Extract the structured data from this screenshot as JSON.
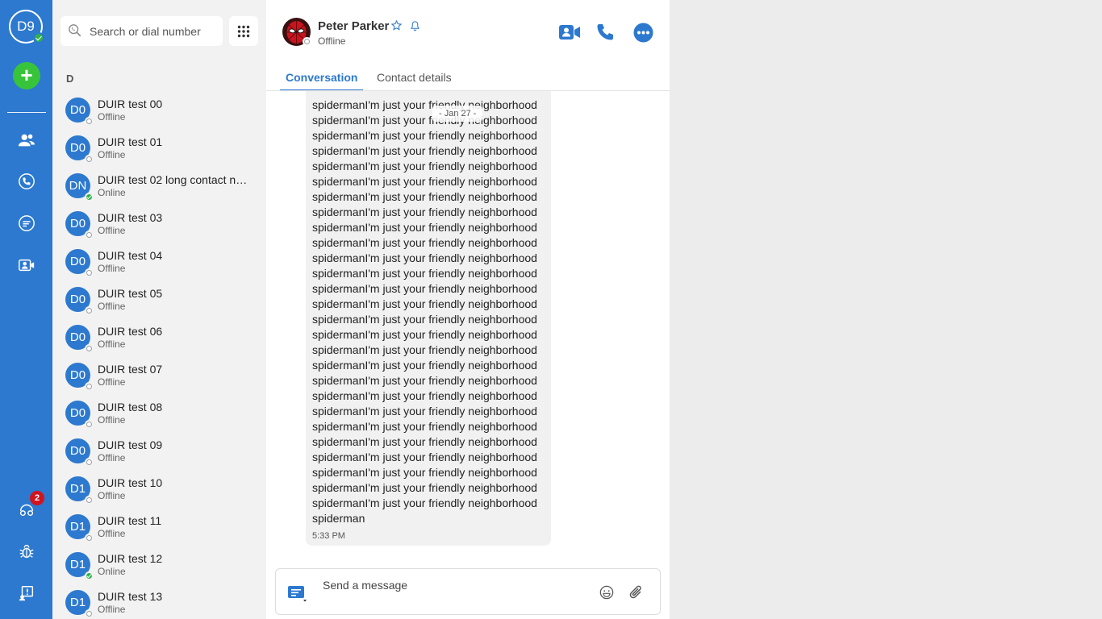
{
  "rail": {
    "user_initials": "D9",
    "notification_count": "2"
  },
  "contacts": {
    "search_placeholder": "Search or dial number",
    "group_letter": "D",
    "items": [
      {
        "initials": "D0",
        "name": "DUIR test 00",
        "status": "Offline"
      },
      {
        "initials": "D0",
        "name": "DUIR test 01",
        "status": "Offline"
      },
      {
        "initials": "DN",
        "name": "DUIR test 02 long contact na...",
        "status": "Online"
      },
      {
        "initials": "D0",
        "name": "DUIR test 03",
        "status": "Offline"
      },
      {
        "initials": "D0",
        "name": "DUIR test 04",
        "status": "Offline"
      },
      {
        "initials": "D0",
        "name": "DUIR test 05",
        "status": "Offline"
      },
      {
        "initials": "D0",
        "name": "DUIR test 06",
        "status": "Offline"
      },
      {
        "initials": "D0",
        "name": "DUIR test 07",
        "status": "Offline"
      },
      {
        "initials": "D0",
        "name": "DUIR test 08",
        "status": "Offline"
      },
      {
        "initials": "D0",
        "name": "DUIR test 09",
        "status": "Offline"
      },
      {
        "initials": "D1",
        "name": "DUIR test 10",
        "status": "Offline"
      },
      {
        "initials": "D1",
        "name": "DUIR test 11",
        "status": "Offline"
      },
      {
        "initials": "D1",
        "name": "DUIR test 12",
        "status": "Online"
      },
      {
        "initials": "D1",
        "name": "DUIR test 13",
        "status": "Offline"
      }
    ]
  },
  "conversation": {
    "peer_name": "Peter Parker",
    "peer_status": "Offline",
    "tabs": [
      {
        "label": "Conversation",
        "active": true
      },
      {
        "label": "Contact details",
        "active": false
      }
    ],
    "date_separator": "- Jan 27 -",
    "message": {
      "lines": [
        "spidermanI'm just your friendly neighborhood",
        "spidermanI'm just your friendly neighborhood",
        "spidermanI'm just your friendly neighborhood",
        "spidermanI'm just your friendly neighborhood",
        "spidermanI'm just your friendly neighborhood",
        "spidermanI'm just your friendly neighborhood",
        "spidermanI'm just your friendly neighborhood",
        "spidermanI'm just your friendly neighborhood",
        "spidermanI'm just your friendly neighborhood",
        "spidermanI'm just your friendly neighborhood",
        "spidermanI'm just your friendly neighborhood",
        "spidermanI'm just your friendly neighborhood",
        "spidermanI'm just your friendly neighborhood",
        "spidermanI'm just your friendly neighborhood",
        "spidermanI'm just your friendly neighborhood",
        "spidermanI'm just your friendly neighborhood",
        "spidermanI'm just your friendly neighborhood",
        "spidermanI'm just your friendly neighborhood",
        "spidermanI'm just your friendly neighborhood",
        "spidermanI'm just your friendly neighborhood",
        "spidermanI'm just your friendly neighborhood",
        "spidermanI'm just your friendly neighborhood",
        "spidermanI'm just your friendly neighborhood",
        "spidermanI'm just your friendly neighborhood",
        "spidermanI'm just your friendly neighborhood",
        "spidermanI'm just your friendly neighborhood",
        "spidermanI'm just your friendly neighborhood",
        "spiderman"
      ],
      "time": "5:33 PM"
    },
    "composer_placeholder": "Send a message"
  },
  "colors": {
    "brand": "#2c79cf",
    "online": "#2db34a",
    "add": "#38c43a",
    "badge": "#d0141f"
  }
}
